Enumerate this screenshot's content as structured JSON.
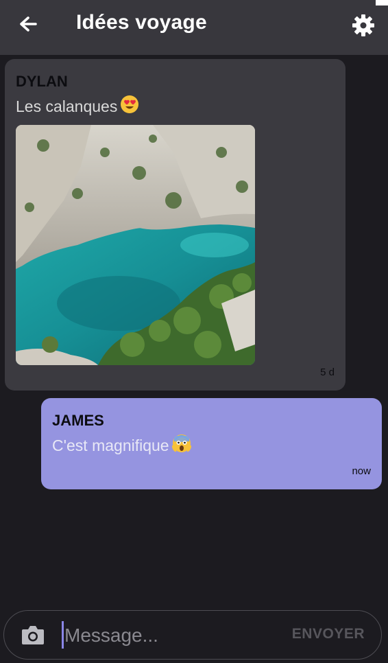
{
  "header": {
    "title": "Idées voyage",
    "back_icon": "arrow-left-icon",
    "settings_icon": "gear-icon"
  },
  "messages": [
    {
      "sender": "DYLAN",
      "text": "Les calanques",
      "emoji": "heart-eyes-emoji",
      "image": "calanque-photo",
      "time": "5 d"
    },
    {
      "sender": "JAMES",
      "text": "C'est magnifique",
      "emoji": "screaming-face-emoji",
      "time": "now"
    }
  ],
  "composer": {
    "camera_icon": "camera-icon",
    "placeholder": "Message...",
    "value": "",
    "send_label": "ENVOYER"
  },
  "colors": {
    "header_bg": "#38373d",
    "background": "#1c1b20",
    "incoming_bubble": "#3b3a40",
    "outgoing_bubble": "#9594e0",
    "accent": "#8a86e6"
  }
}
